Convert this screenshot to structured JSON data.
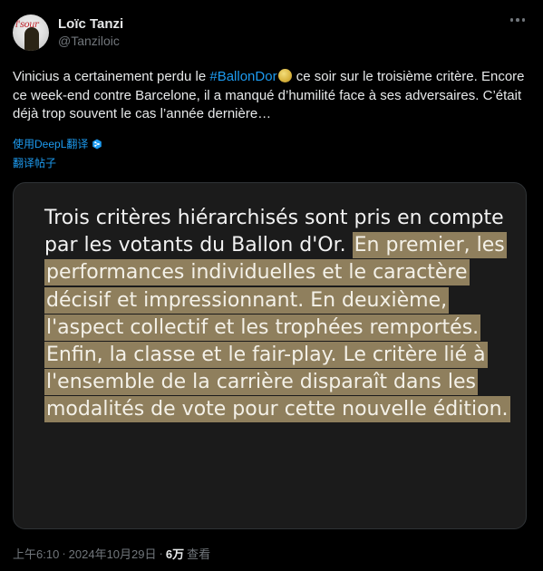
{
  "author": {
    "display_name": "Loïc Tanzi",
    "handle": "@Tanziloic",
    "avatar_icon": "profile-photo"
  },
  "tweet": {
    "text_before_hashtag": "Vinicius a certainement perdu le ",
    "hashtag": "#BallonDor",
    "hashtag_emoji": "ballon-dor-icon",
    "text_after_hashtag": " ce soir sur le troisième critère. Encore ce week-end contre Barcelone, il a manqué d’humilité face à ses adversaires. C’était déjà trop souvent le cas l’année dernière…"
  },
  "translation": {
    "translated_by_label": "使用DeepL翻译",
    "translate_post_label": "翻译帖子"
  },
  "media": {
    "plain_text": "Trois critères hiérarchisés sont pris en compte par les votants du Ballon d'Or. ",
    "highlighted_text": "En premier, les performances individuelles et le caractère décisif et impressionnant. En deuxième, l'aspect collectif et les trophées remportés. Enfin, la classe et le fair-play. Le critère lié à l'ensemble de la carrière disparaît dans les modalités de vote pour cette nouvelle édition.",
    "highlight_color": "#8f7f5d",
    "background_color": "#1b1b1b"
  },
  "meta": {
    "time": "上午6:10",
    "separator1": "·",
    "date": "2024年10月29日",
    "separator2": "·",
    "views_count": "6万",
    "views_label": "查看"
  },
  "colors": {
    "accent": "#1d9bf0",
    "text": "#e7e9ea",
    "secondary": "#71767b",
    "background": "#000000"
  }
}
